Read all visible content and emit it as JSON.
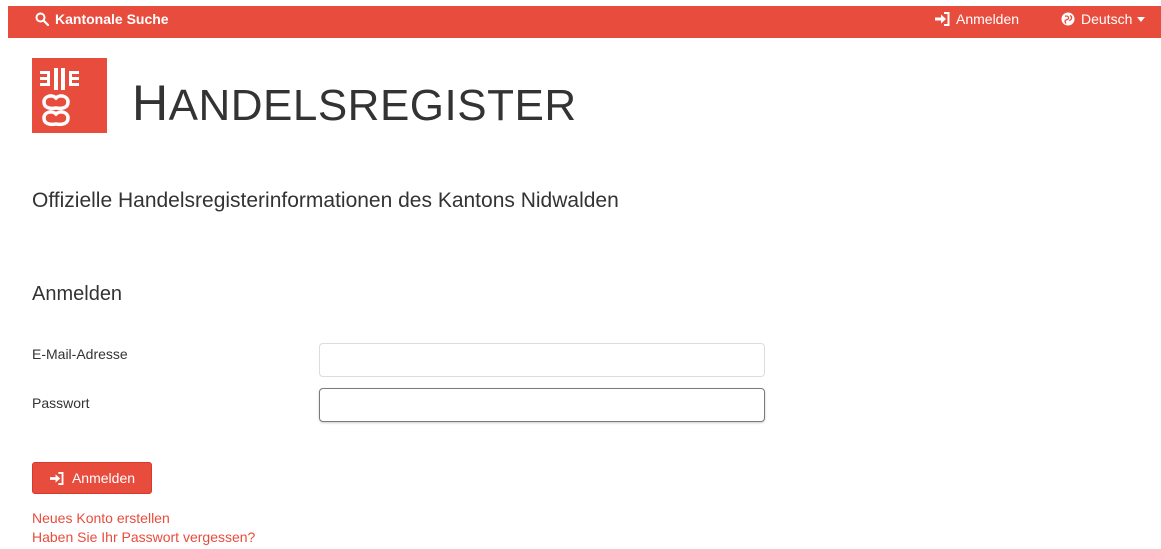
{
  "topbar": {
    "search_label": "Kantonale Suche",
    "login_label": "Anmelden",
    "language_label": "Deutsch"
  },
  "brand": {
    "title_first": "H",
    "title_rest": "ANDELSREGISTER"
  },
  "subtitle": "Offizielle Handelsregisterinformationen des Kantons Nidwalden",
  "login": {
    "heading": "Anmelden",
    "email_label": "E-Mail-Adresse",
    "email_value": "",
    "password_label": "Passwort",
    "password_value": "",
    "submit_label": "Anmelden"
  },
  "links": {
    "new_account": "Neues Konto erstellen",
    "forgot_password": "Haben Sie Ihr Passwort vergessen?"
  },
  "colors": {
    "accent": "#e84c3d",
    "text": "#333333"
  },
  "icons": {
    "search": "search-icon",
    "login": "sign-in-icon",
    "language": "globe-icon",
    "caret": "caret-down-icon",
    "logo": "coat-of-arms-logo"
  }
}
